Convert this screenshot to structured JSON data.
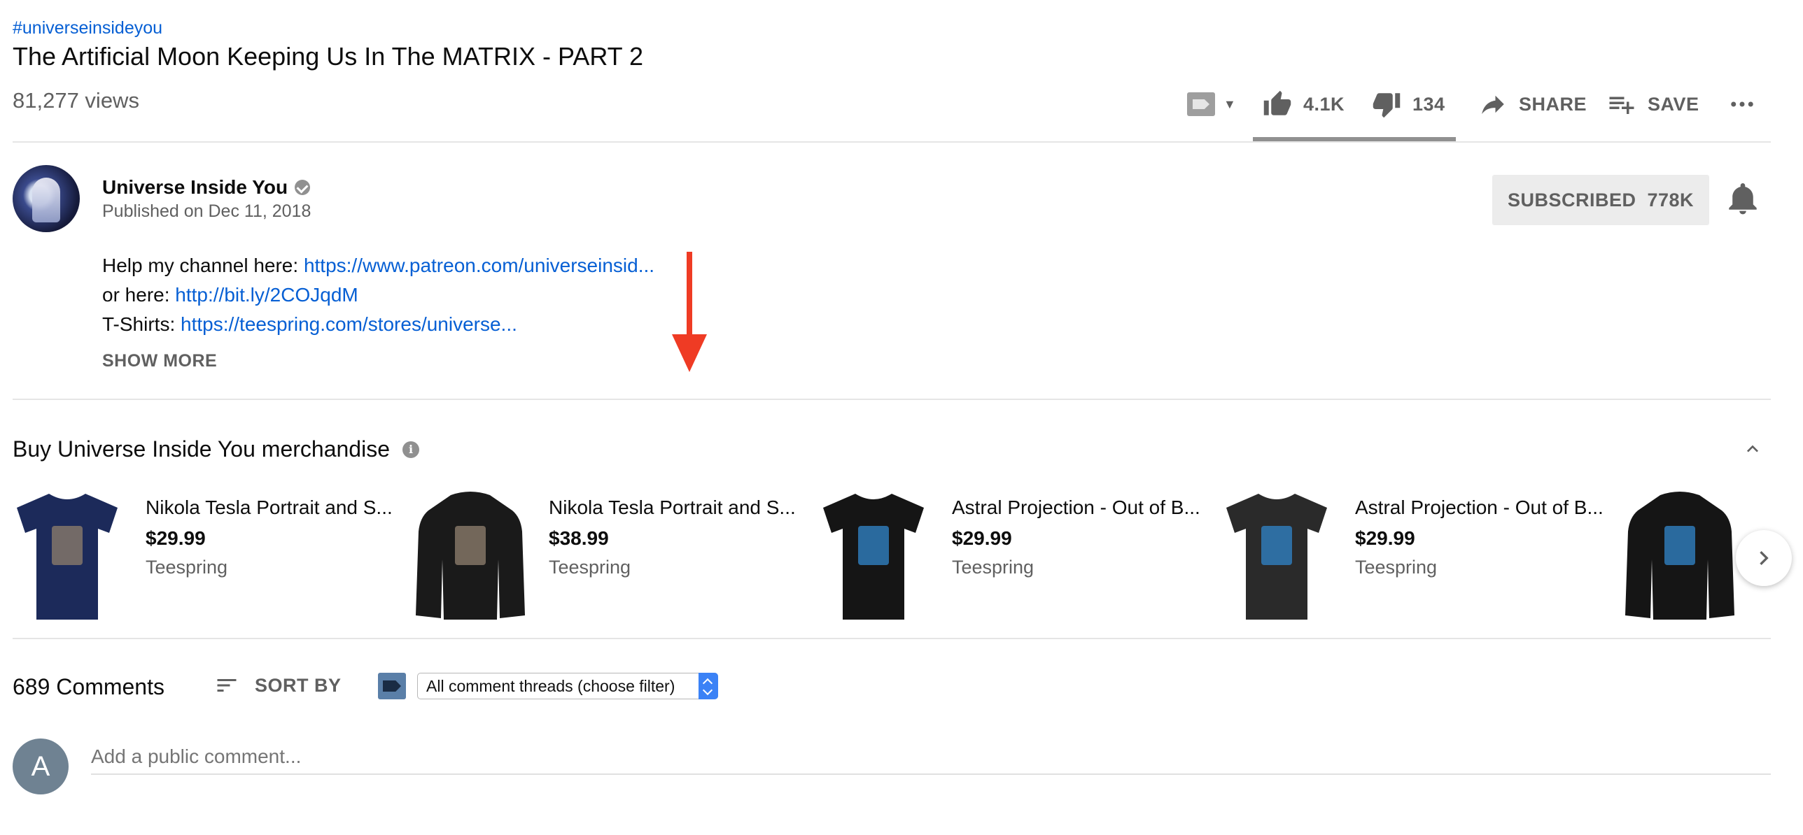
{
  "video": {
    "hashtag": "#universeinsideyou",
    "title": "The Artificial Moon Keeping Us In The MATRIX - PART 2",
    "views": "81,277 views"
  },
  "actions": {
    "like_count": "4.1K",
    "dislike_count": "134",
    "share_label": "SHARE",
    "save_label": "SAVE"
  },
  "channel": {
    "name": "Universe Inside You",
    "published": "Published on Dec 11, 2018",
    "subscribed_label": "SUBSCRIBED",
    "subscriber_count": "778K"
  },
  "description": {
    "line1_prefix": "Help my channel here: ",
    "line1_link": "https://www.patreon.com/universeinsid...",
    "line2_prefix": "or here: ",
    "line2_link": "http://bit.ly/2COJqdM",
    "line3_prefix": "T-Shirts: ",
    "line3_link": "https://teespring.com/stores/universe...",
    "show_more": "SHOW MORE"
  },
  "merch": {
    "title": "Buy Universe Inside You merchandise",
    "items": [
      {
        "name": "Nikola Tesla Portrait and S...",
        "price": "$29.99",
        "seller": "Teespring",
        "type": "tshirt",
        "color": "#1c2a5a"
      },
      {
        "name": "Nikola Tesla Portrait and S...",
        "price": "$38.99",
        "seller": "Teespring",
        "type": "hoodie",
        "color": "#1a1a1a"
      },
      {
        "name": "Astral Projection - Out of B...",
        "price": "$29.99",
        "seller": "Teespring",
        "type": "tshirt",
        "color": "#151515"
      },
      {
        "name": "Astral Projection - Out of B...",
        "price": "$29.99",
        "seller": "Teespring",
        "type": "tshirt",
        "color": "#2a2a2a"
      },
      {
        "name": "",
        "price": "",
        "seller": "",
        "type": "hoodie",
        "color": "#151515"
      }
    ]
  },
  "comments": {
    "count": "689 Comments",
    "sort_label": "SORT BY",
    "filter_value": "All comment threads (choose filter)",
    "user_initial": "A",
    "input_placeholder": "Add a public comment..."
  }
}
